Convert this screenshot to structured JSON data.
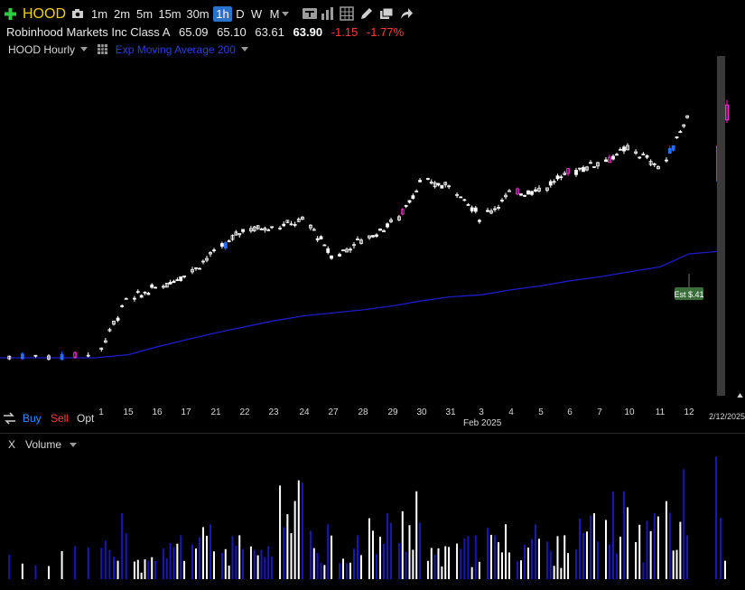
{
  "toolbar": {
    "symbol": "HOOD",
    "timeframes": [
      "1m",
      "2m",
      "5m",
      "15m",
      "30m",
      "1h",
      "D",
      "W",
      "M"
    ],
    "selected_timeframe": "1h"
  },
  "quote": {
    "name": "Robinhood Markets Inc Class A",
    "open": "65.09",
    "high": "65.10",
    "low": "63.61",
    "last": "63.90",
    "change": "-1.15",
    "change_pct": "-1.77%"
  },
  "studies": {
    "chart_label": "HOOD Hourly",
    "ma_label": "Exp Moving Average 200"
  },
  "trade_bar": {
    "buy": "Buy",
    "sell": "Sell",
    "opt": "Opt"
  },
  "xaxis": {
    "day_labels": [
      "1",
      "15",
      "16",
      "17",
      "21",
      "22",
      "23",
      "24",
      "27",
      "28",
      "29",
      "30",
      "31",
      "3",
      "4",
      "5",
      "6",
      "7",
      "10",
      "11",
      "12"
    ],
    "month_label": "Feb 2025",
    "date_label": "2/12/2025"
  },
  "earnings_marker": "Est $.41",
  "volume_pane": {
    "close_label": "X",
    "title": "Volume"
  },
  "colors": {
    "up": "#2c6cf0",
    "down": "#ff2bd3",
    "neutral": "#ffffff",
    "ma": "#1c1cc9",
    "volume_up": "#1a16b8",
    "volume_down": "#ffffff",
    "symbol": "#f0d000",
    "neg": "#ff3b3b"
  },
  "chart_data": {
    "type": "line",
    "title": "HOOD Hourly",
    "series": [
      {
        "name": "HOOD",
        "x": [
          "1/14",
          "1/15",
          "1/16",
          "1/17",
          "1/21",
          "1/22",
          "1/23",
          "1/24",
          "1/27",
          "1/28",
          "1/29",
          "1/30",
          "1/31",
          "2/3",
          "2/4",
          "2/5",
          "2/6",
          "2/7",
          "2/10",
          "2/11",
          "2/12"
        ],
        "values": [
          40.1,
          45.6,
          46.8,
          48.2,
          50.4,
          52.7,
          52.9,
          53.5,
          50.0,
          51.6,
          53.3,
          57.3,
          57.0,
          53.9,
          56.2,
          56.7,
          58.4,
          59.4,
          60.7,
          58.9,
          63.9
        ]
      },
      {
        "name": "Exp Moving Average 200",
        "x": [
          "1/14",
          "1/15",
          "1/16",
          "1/17",
          "1/21",
          "1/22",
          "1/23",
          "1/24",
          "1/27",
          "1/28",
          "1/29",
          "1/30",
          "1/31",
          "2/3",
          "2/4",
          "2/5",
          "2/6",
          "2/7",
          "2/10",
          "2/11",
          "2/12"
        ],
        "values": [
          39.8,
          40.1,
          40.9,
          41.6,
          42.3,
          42.9,
          43.5,
          44.0,
          44.3,
          44.6,
          45.0,
          45.5,
          45.9,
          46.1,
          46.6,
          47.0,
          47.5,
          47.9,
          48.4,
          48.9,
          50.2
        ]
      }
    ],
    "volume": [
      3,
      6,
      2,
      4,
      5,
      4,
      3,
      9,
      5,
      4,
      6,
      8,
      3,
      4,
      5,
      5,
      4,
      6,
      8,
      6,
      10
    ]
  }
}
